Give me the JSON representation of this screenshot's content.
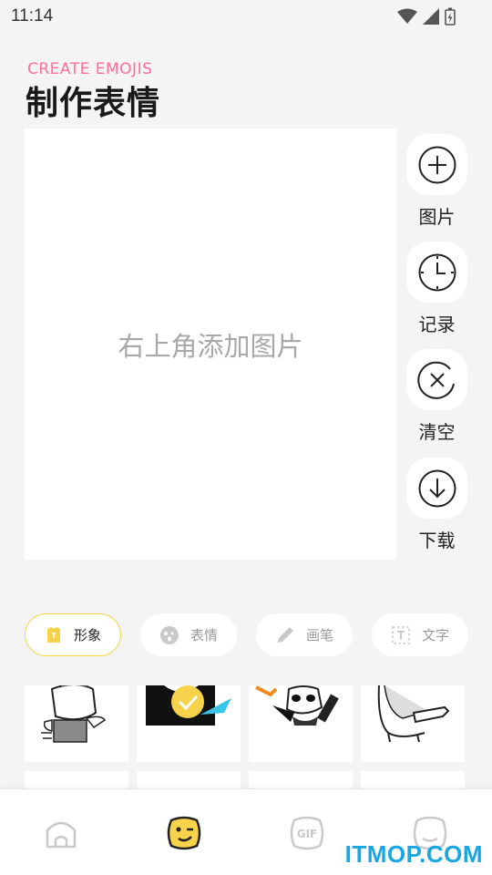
{
  "status": {
    "time": "11:14"
  },
  "header": {
    "subtitle": "CREATE EMOJIS",
    "title": "制作表情"
  },
  "canvas": {
    "placeholder": "右上角添加图片"
  },
  "side_actions": [
    {
      "label": "图片",
      "icon": "plus-circle-icon"
    },
    {
      "label": "记录",
      "icon": "clock-icon"
    },
    {
      "label": "清空",
      "icon": "clear-x-icon"
    },
    {
      "label": "下载",
      "icon": "download-icon"
    }
  ],
  "tabs": [
    {
      "label": "形象",
      "icon": "shirt-icon",
      "active": true
    },
    {
      "label": "表情",
      "icon": "face-icon",
      "active": false
    },
    {
      "label": "画笔",
      "icon": "pen-icon",
      "active": false
    },
    {
      "label": "文字",
      "icon": "text-box-icon",
      "active": false
    }
  ],
  "bottom_nav": [
    {
      "icon": "home-icon",
      "active": false
    },
    {
      "icon": "emoji-wink-icon",
      "active": true
    },
    {
      "icon": "gif-icon",
      "active": false
    },
    {
      "icon": "profile-face-icon",
      "active": false
    }
  ],
  "colors": {
    "accent_yellow": "#f6d34a",
    "subtitle_pink": "#ff6e9a",
    "watermark_blue": "#1aa6e2"
  },
  "watermark": "ITMOP.COM"
}
